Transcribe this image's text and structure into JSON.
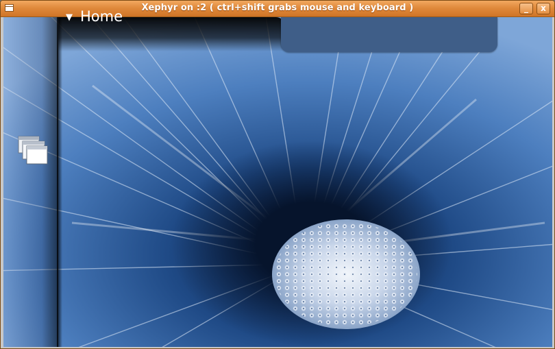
{
  "window": {
    "title": "Xephyr on :2 ( ctrl+shift grabs mouse and keyboard )",
    "minimize_glyph": "_",
    "close_glyph": "x"
  },
  "desktop": {
    "home_arrow": "▼",
    "home_label": "Home",
    "icons": [
      "windows-stack-icon"
    ],
    "wallpaper_subject": "dandelion-macro",
    "colors": {
      "titlebar": "#e08a3c",
      "wallpaper_base": "#1c3f73",
      "tab": "#3f5e88"
    }
  }
}
